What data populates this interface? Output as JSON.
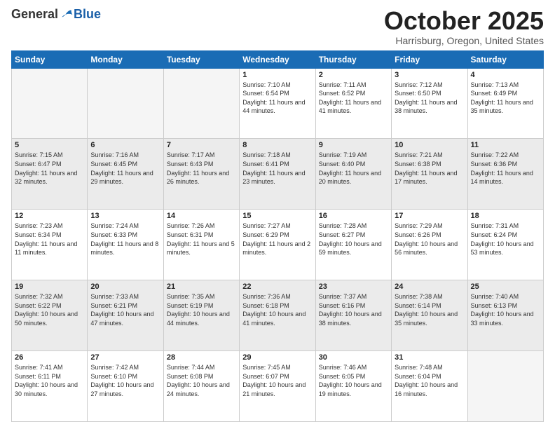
{
  "logo": {
    "general": "General",
    "blue": "Blue"
  },
  "header": {
    "month": "October 2025",
    "location": "Harrisburg, Oregon, United States"
  },
  "days_of_week": [
    "Sunday",
    "Monday",
    "Tuesday",
    "Wednesday",
    "Thursday",
    "Friday",
    "Saturday"
  ],
  "weeks": [
    [
      {
        "day": "",
        "info": ""
      },
      {
        "day": "",
        "info": ""
      },
      {
        "day": "",
        "info": ""
      },
      {
        "day": "1",
        "info": "Sunrise: 7:10 AM\nSunset: 6:54 PM\nDaylight: 11 hours and 44 minutes."
      },
      {
        "day": "2",
        "info": "Sunrise: 7:11 AM\nSunset: 6:52 PM\nDaylight: 11 hours and 41 minutes."
      },
      {
        "day": "3",
        "info": "Sunrise: 7:12 AM\nSunset: 6:50 PM\nDaylight: 11 hours and 38 minutes."
      },
      {
        "day": "4",
        "info": "Sunrise: 7:13 AM\nSunset: 6:49 PM\nDaylight: 11 hours and 35 minutes."
      }
    ],
    [
      {
        "day": "5",
        "info": "Sunrise: 7:15 AM\nSunset: 6:47 PM\nDaylight: 11 hours and 32 minutes."
      },
      {
        "day": "6",
        "info": "Sunrise: 7:16 AM\nSunset: 6:45 PM\nDaylight: 11 hours and 29 minutes."
      },
      {
        "day": "7",
        "info": "Sunrise: 7:17 AM\nSunset: 6:43 PM\nDaylight: 11 hours and 26 minutes."
      },
      {
        "day": "8",
        "info": "Sunrise: 7:18 AM\nSunset: 6:41 PM\nDaylight: 11 hours and 23 minutes."
      },
      {
        "day": "9",
        "info": "Sunrise: 7:19 AM\nSunset: 6:40 PM\nDaylight: 11 hours and 20 minutes."
      },
      {
        "day": "10",
        "info": "Sunrise: 7:21 AM\nSunset: 6:38 PM\nDaylight: 11 hours and 17 minutes."
      },
      {
        "day": "11",
        "info": "Sunrise: 7:22 AM\nSunset: 6:36 PM\nDaylight: 11 hours and 14 minutes."
      }
    ],
    [
      {
        "day": "12",
        "info": "Sunrise: 7:23 AM\nSunset: 6:34 PM\nDaylight: 11 hours and 11 minutes."
      },
      {
        "day": "13",
        "info": "Sunrise: 7:24 AM\nSunset: 6:33 PM\nDaylight: 11 hours and 8 minutes."
      },
      {
        "day": "14",
        "info": "Sunrise: 7:26 AM\nSunset: 6:31 PM\nDaylight: 11 hours and 5 minutes."
      },
      {
        "day": "15",
        "info": "Sunrise: 7:27 AM\nSunset: 6:29 PM\nDaylight: 11 hours and 2 minutes."
      },
      {
        "day": "16",
        "info": "Sunrise: 7:28 AM\nSunset: 6:27 PM\nDaylight: 10 hours and 59 minutes."
      },
      {
        "day": "17",
        "info": "Sunrise: 7:29 AM\nSunset: 6:26 PM\nDaylight: 10 hours and 56 minutes."
      },
      {
        "day": "18",
        "info": "Sunrise: 7:31 AM\nSunset: 6:24 PM\nDaylight: 10 hours and 53 minutes."
      }
    ],
    [
      {
        "day": "19",
        "info": "Sunrise: 7:32 AM\nSunset: 6:22 PM\nDaylight: 10 hours and 50 minutes."
      },
      {
        "day": "20",
        "info": "Sunrise: 7:33 AM\nSunset: 6:21 PM\nDaylight: 10 hours and 47 minutes."
      },
      {
        "day": "21",
        "info": "Sunrise: 7:35 AM\nSunset: 6:19 PM\nDaylight: 10 hours and 44 minutes."
      },
      {
        "day": "22",
        "info": "Sunrise: 7:36 AM\nSunset: 6:18 PM\nDaylight: 10 hours and 41 minutes."
      },
      {
        "day": "23",
        "info": "Sunrise: 7:37 AM\nSunset: 6:16 PM\nDaylight: 10 hours and 38 minutes."
      },
      {
        "day": "24",
        "info": "Sunrise: 7:38 AM\nSunset: 6:14 PM\nDaylight: 10 hours and 35 minutes."
      },
      {
        "day": "25",
        "info": "Sunrise: 7:40 AM\nSunset: 6:13 PM\nDaylight: 10 hours and 33 minutes."
      }
    ],
    [
      {
        "day": "26",
        "info": "Sunrise: 7:41 AM\nSunset: 6:11 PM\nDaylight: 10 hours and 30 minutes."
      },
      {
        "day": "27",
        "info": "Sunrise: 7:42 AM\nSunset: 6:10 PM\nDaylight: 10 hours and 27 minutes."
      },
      {
        "day": "28",
        "info": "Sunrise: 7:44 AM\nSunset: 6:08 PM\nDaylight: 10 hours and 24 minutes."
      },
      {
        "day": "29",
        "info": "Sunrise: 7:45 AM\nSunset: 6:07 PM\nDaylight: 10 hours and 21 minutes."
      },
      {
        "day": "30",
        "info": "Sunrise: 7:46 AM\nSunset: 6:05 PM\nDaylight: 10 hours and 19 minutes."
      },
      {
        "day": "31",
        "info": "Sunrise: 7:48 AM\nSunset: 6:04 PM\nDaylight: 10 hours and 16 minutes."
      },
      {
        "day": "",
        "info": ""
      }
    ]
  ]
}
